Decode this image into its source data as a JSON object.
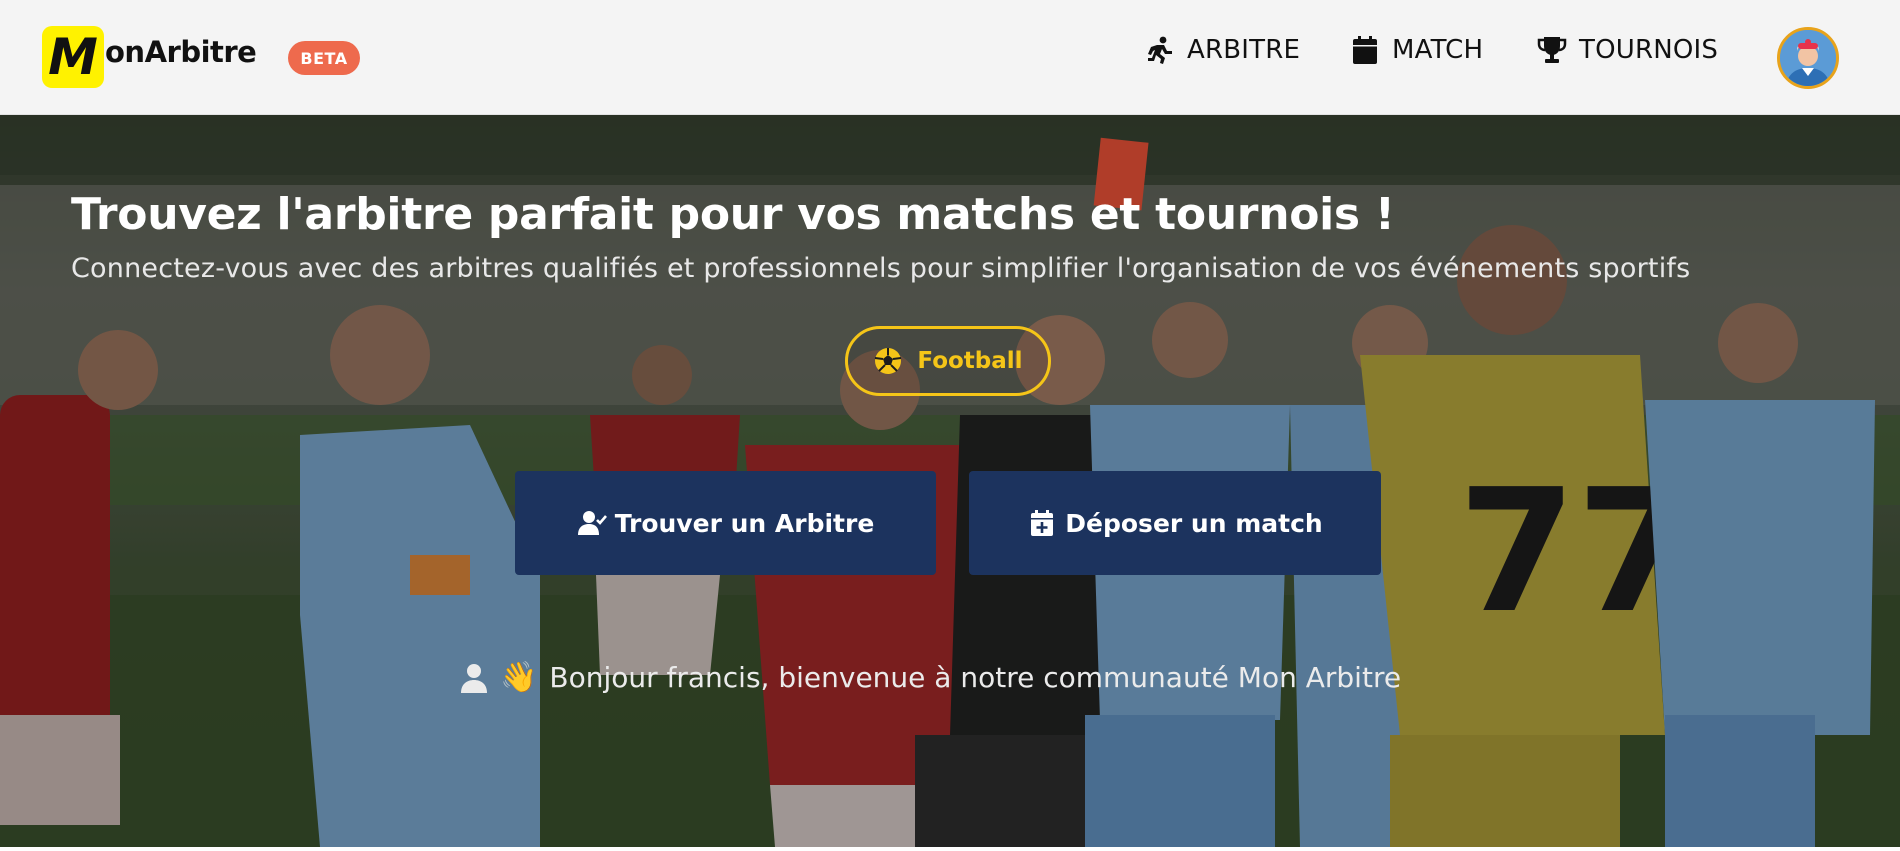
{
  "header": {
    "logo_mark": "M",
    "logo_text": "onArbitre",
    "beta_label": "BETA",
    "nav": [
      {
        "label": "ARBITRE",
        "icon": "running-person-icon"
      },
      {
        "label": "MATCH",
        "icon": "calendar-icon"
      },
      {
        "label": "TOURNOIS",
        "icon": "trophy-icon"
      }
    ],
    "avatar_icon": "referee-avatar-icon"
  },
  "hero": {
    "title": "Trouvez l'arbitre parfait pour vos matchs et tournois !",
    "subtitle": "Connectez-vous avec des arbitres qualifiés et professionnels pour simplifier l'organisation de vos événements sportifs",
    "sport_chip": {
      "label": "Football",
      "icon": "soccer-ball-icon"
    },
    "buttons": {
      "find_referee": {
        "label": "Trouver un Arbitre",
        "icon": "user-check-icon"
      },
      "post_match": {
        "label": "Déposer un match",
        "icon": "calendar-plus-icon"
      }
    },
    "welcome": {
      "text": "Bonjour francis, bienvenue à notre communauté Mon Arbitre",
      "emoji": "👋",
      "icon": "user-icon"
    },
    "background": "referee showing red card to football players"
  },
  "colors": {
    "accent_yellow": "#f5c518",
    "navy_button": "#1c335e",
    "beta_badge": "#ee6a4d",
    "logo_yellow": "#fff200"
  }
}
